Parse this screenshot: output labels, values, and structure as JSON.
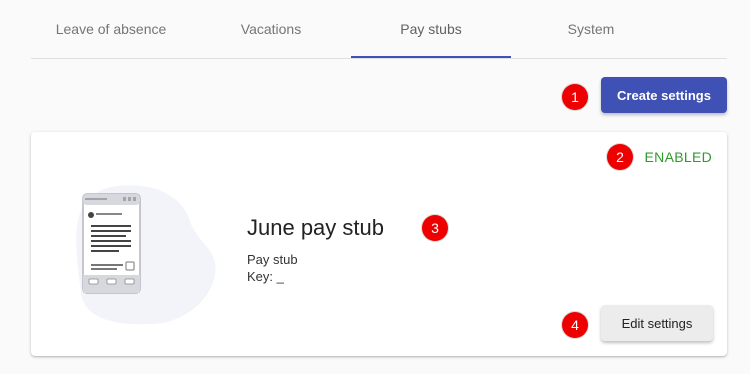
{
  "tabs": [
    {
      "label": "Leave of absence",
      "active": false
    },
    {
      "label": "Vacations",
      "active": false
    },
    {
      "label": "Pay stubs",
      "active": true
    },
    {
      "label": "System",
      "active": false
    }
  ],
  "toolbar": {
    "create_label": "Create settings"
  },
  "card": {
    "status": "ENABLED",
    "title": "June pay stub",
    "subtitle": "Pay stub",
    "key_line": "Key: _",
    "edit_label": "Edit settings",
    "illustration": "pay-stub-document-icon"
  },
  "annotations": [
    "1",
    "2",
    "3",
    "4"
  ],
  "colors": {
    "accent": "#3f51b5",
    "status_enabled": "#2e9b2e",
    "annotation": "#ee0000"
  }
}
